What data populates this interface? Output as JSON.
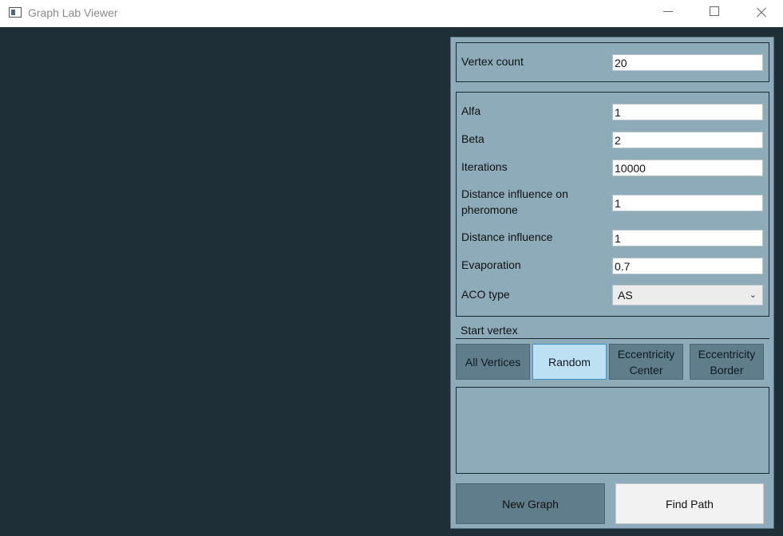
{
  "window": {
    "title": "Graph Lab Viewer"
  },
  "vertex_group": {
    "label": "Vertex count",
    "value": "20"
  },
  "params": {
    "alfa": {
      "label": "Alfa",
      "value": "1"
    },
    "beta": {
      "label": "Beta",
      "value": "2"
    },
    "iterations": {
      "label": "Iterations",
      "value": "10000"
    },
    "distance_pheromone": {
      "label_line1": "Distance influence on",
      "label_line2": "pheromone",
      "value": "1"
    },
    "distance_influence": {
      "label": "Distance influence",
      "value": "1"
    },
    "evaporation": {
      "label": "Evaporation",
      "value": "0.7"
    },
    "aco_type": {
      "label": "ACO type",
      "value": "AS"
    }
  },
  "start_vertex": {
    "label": "Start vertex",
    "options": [
      {
        "line1": "All Vertices",
        "line2": ""
      },
      {
        "line1": "Random",
        "line2": ""
      },
      {
        "line1": "Eccentricity",
        "line2": "Center"
      },
      {
        "line1": "Eccentricity",
        "line2": "Border"
      }
    ],
    "selected": "Random"
  },
  "actions": {
    "new_graph": "New Graph",
    "find_path": "Find Path"
  },
  "colors": {
    "canvas": "#1e2f38",
    "panel": "#8eabba",
    "button": "#5f7d8a",
    "selected_button": "#bde0f3"
  },
  "icons": {
    "app": "window-icon",
    "minimize": "minimize-icon",
    "maximize": "maximize-icon",
    "close": "close-icon",
    "dropdown": "chevron-down-icon"
  }
}
